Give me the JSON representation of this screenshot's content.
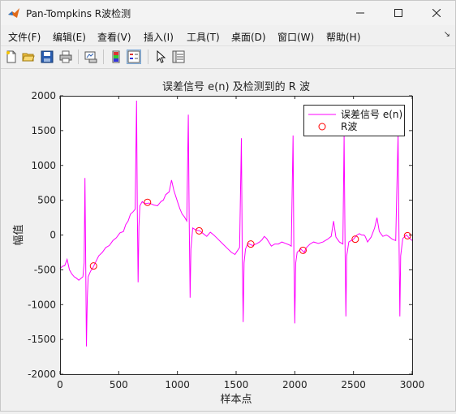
{
  "window": {
    "title": "Pan-Tompkins R波检测"
  },
  "menu": {
    "items": [
      "文件(F)",
      "编辑(E)",
      "查看(V)",
      "插入(I)",
      "工具(T)",
      "桌面(D)",
      "窗口(W)",
      "帮助(H)"
    ]
  },
  "toolbar": {
    "icons": [
      "new-figure-icon",
      "open-file-icon",
      "save-icon",
      "print-icon",
      "link-plot-icon",
      "insert-colorbar-icon",
      "insert-legend-icon",
      "edit-plot-pointer-icon",
      "property-inspector-icon"
    ]
  },
  "chart_data": {
    "type": "line",
    "title": "误差信号 e(n) 及检测到的 R 波",
    "xlabel": "样本点",
    "ylabel": "幅值",
    "xlim": [
      0,
      3000
    ],
    "ylim": [
      -2000,
      2000
    ],
    "xticks": [
      0,
      500,
      1000,
      1500,
      2000,
      2500,
      3000
    ],
    "yticks": [
      -2000,
      -1500,
      -1000,
      -500,
      0,
      500,
      1000,
      1500,
      2000
    ],
    "legend_position": "top-right",
    "grid": false,
    "series": [
      {
        "name": "误差信号 e(n)",
        "color": "#ff00ff",
        "style": "line",
        "points": [
          [
            0,
            -480
          ],
          [
            20,
            -450
          ],
          [
            40,
            -440
          ],
          [
            60,
            -350
          ],
          [
            80,
            -500
          ],
          [
            100,
            -560
          ],
          [
            120,
            -600
          ],
          [
            140,
            -620
          ],
          [
            160,
            -650
          ],
          [
            180,
            -620
          ],
          [
            195,
            -600
          ],
          [
            205,
            -400
          ],
          [
            212,
            820
          ],
          [
            218,
            -200
          ],
          [
            225,
            -1600
          ],
          [
            232,
            -900
          ],
          [
            240,
            -600
          ],
          [
            260,
            -520
          ],
          [
            280,
            -470
          ],
          [
            300,
            -400
          ],
          [
            330,
            -300
          ],
          [
            360,
            -250
          ],
          [
            390,
            -180
          ],
          [
            420,
            -150
          ],
          [
            450,
            -80
          ],
          [
            480,
            -40
          ],
          [
            510,
            30
          ],
          [
            540,
            50
          ],
          [
            560,
            150
          ],
          [
            580,
            200
          ],
          [
            600,
            300
          ],
          [
            620,
            330
          ],
          [
            640,
            370
          ],
          [
            652,
            1930
          ],
          [
            658,
            400
          ],
          [
            665,
            -680
          ],
          [
            672,
            120
          ],
          [
            680,
            420
          ],
          [
            700,
            480
          ],
          [
            720,
            450
          ],
          [
            760,
            460
          ],
          [
            800,
            430
          ],
          [
            830,
            420
          ],
          [
            860,
            480
          ],
          [
            880,
            500
          ],
          [
            900,
            580
          ],
          [
            930,
            620
          ],
          [
            950,
            790
          ],
          [
            970,
            640
          ],
          [
            1000,
            480
          ],
          [
            1020,
            380
          ],
          [
            1040,
            300
          ],
          [
            1060,
            260
          ],
          [
            1080,
            200
          ],
          [
            1093,
            1730
          ],
          [
            1100,
            300
          ],
          [
            1108,
            -900
          ],
          [
            1115,
            -200
          ],
          [
            1130,
            100
          ],
          [
            1160,
            70
          ],
          [
            1190,
            60
          ],
          [
            1220,
            20
          ],
          [
            1250,
            -20
          ],
          [
            1280,
            40
          ],
          [
            1310,
            0
          ],
          [
            1340,
            -50
          ],
          [
            1370,
            -100
          ],
          [
            1400,
            -150
          ],
          [
            1430,
            -200
          ],
          [
            1460,
            -250
          ],
          [
            1490,
            -280
          ],
          [
            1510,
            -230
          ],
          [
            1530,
            -180
          ],
          [
            1545,
            1390
          ],
          [
            1552,
            -200
          ],
          [
            1560,
            -1250
          ],
          [
            1568,
            -400
          ],
          [
            1580,
            -200
          ],
          [
            1600,
            -120
          ],
          [
            1640,
            -150
          ],
          [
            1680,
            -120
          ],
          [
            1700,
            -100
          ],
          [
            1720,
            -70
          ],
          [
            1740,
            -20
          ],
          [
            1760,
            -50
          ],
          [
            1800,
            -160
          ],
          [
            1830,
            -130
          ],
          [
            1860,
            -130
          ],
          [
            1890,
            -100
          ],
          [
            1920,
            -120
          ],
          [
            1950,
            -140
          ],
          [
            1970,
            -160
          ],
          [
            1985,
            1430
          ],
          [
            1992,
            -300
          ],
          [
            2000,
            -1270
          ],
          [
            2008,
            -400
          ],
          [
            2020,
            -250
          ],
          [
            2050,
            -200
          ],
          [
            2080,
            -250
          ],
          [
            2100,
            -180
          ],
          [
            2130,
            -130
          ],
          [
            2160,
            -100
          ],
          [
            2200,
            -120
          ],
          [
            2240,
            -100
          ],
          [
            2280,
            -60
          ],
          [
            2310,
            -20
          ],
          [
            2330,
            200
          ],
          [
            2350,
            -30
          ],
          [
            2380,
            -100
          ],
          [
            2410,
            -130
          ],
          [
            2420,
            1430
          ],
          [
            2428,
            -200
          ],
          [
            2435,
            -1170
          ],
          [
            2442,
            -300
          ],
          [
            2460,
            -100
          ],
          [
            2500,
            -60
          ],
          [
            2530,
            0
          ],
          [
            2550,
            20
          ],
          [
            2570,
            0
          ],
          [
            2590,
            0
          ],
          [
            2600,
            -20
          ],
          [
            2620,
            -100
          ],
          [
            2650,
            -30
          ],
          [
            2680,
            100
          ],
          [
            2700,
            250
          ],
          [
            2720,
            50
          ],
          [
            2750,
            -20
          ],
          [
            2780,
            0
          ],
          [
            2800,
            -20
          ],
          [
            2830,
            -60
          ],
          [
            2860,
            -80
          ],
          [
            2880,
            1450
          ],
          [
            2888,
            -100
          ],
          [
            2895,
            -1170
          ],
          [
            2902,
            -300
          ],
          [
            2920,
            -50
          ],
          [
            2950,
            0
          ],
          [
            2980,
            -50
          ],
          [
            3000,
            -80
          ]
        ]
      },
      {
        "name": "R波",
        "color": "#ff0000",
        "style": "circle",
        "points": [
          [
            285,
            -445
          ],
          [
            745,
            470
          ],
          [
            1185,
            60
          ],
          [
            1625,
            -130
          ],
          [
            2070,
            -220
          ],
          [
            2515,
            -60
          ],
          [
            2960,
            -10
          ]
        ]
      }
    ]
  }
}
